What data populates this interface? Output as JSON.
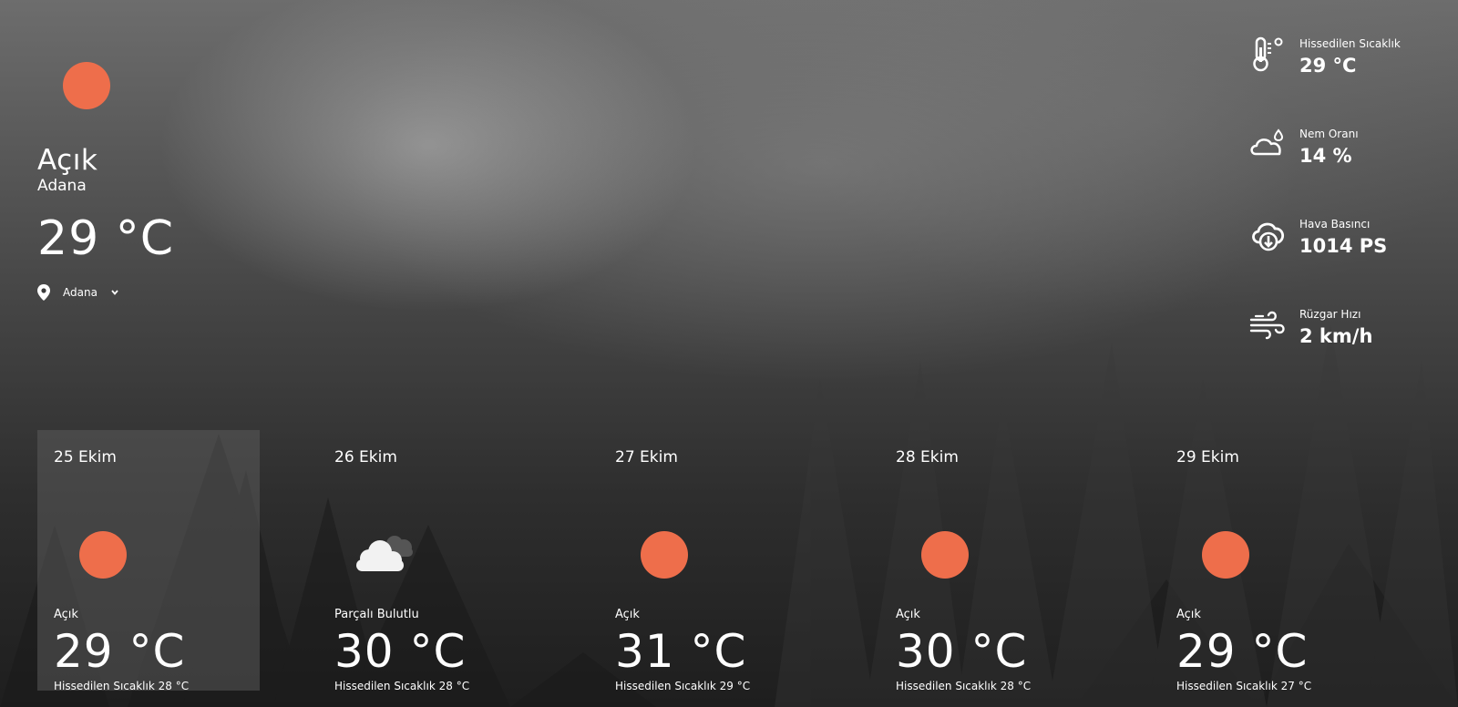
{
  "current": {
    "condition": "Açık",
    "city": "Adana",
    "temperature": "29 °C",
    "location_select": "Adana",
    "icon": "sun-icon",
    "sun_color": "#ee6e4b"
  },
  "stats": [
    {
      "label": "Hissedilen Sıcaklık",
      "value": "29 °C",
      "icon": "thermometer-icon"
    },
    {
      "label": "Nem Oranı",
      "value": "14 %",
      "icon": "humidity-cloud-icon"
    },
    {
      "label": "Hava Basıncı",
      "value": "1014 PS",
      "icon": "cloud-download-icon"
    },
    {
      "label": "Rüzgar Hızı",
      "value": "2 km/h",
      "icon": "wind-icon"
    }
  ],
  "forecast": [
    {
      "date": "25 Ekim",
      "condition": "Açık",
      "temperature": "29 °C",
      "feels": "Hissedilen Sıcaklık 28 °C",
      "icon": "sun-icon"
    },
    {
      "date": "26 Ekim",
      "condition": "Parçalı Bulutlu",
      "temperature": "30 °C",
      "feels": "Hissedilen Sıcaklık 28 °C",
      "icon": "partly-cloudy-icon"
    },
    {
      "date": "27 Ekim",
      "condition": "Açık",
      "temperature": "31 °C",
      "feels": "Hissedilen Sıcaklık 29 °C",
      "icon": "sun-icon"
    },
    {
      "date": "28 Ekim",
      "condition": "Açık",
      "temperature": "30 °C",
      "feels": "Hissedilen Sıcaklık 28 °C",
      "icon": "sun-icon"
    },
    {
      "date": "29 Ekim",
      "condition": "Açık",
      "temperature": "29 °C",
      "feels": "Hissedilen Sıcaklık 27 °C",
      "icon": "sun-icon"
    }
  ]
}
